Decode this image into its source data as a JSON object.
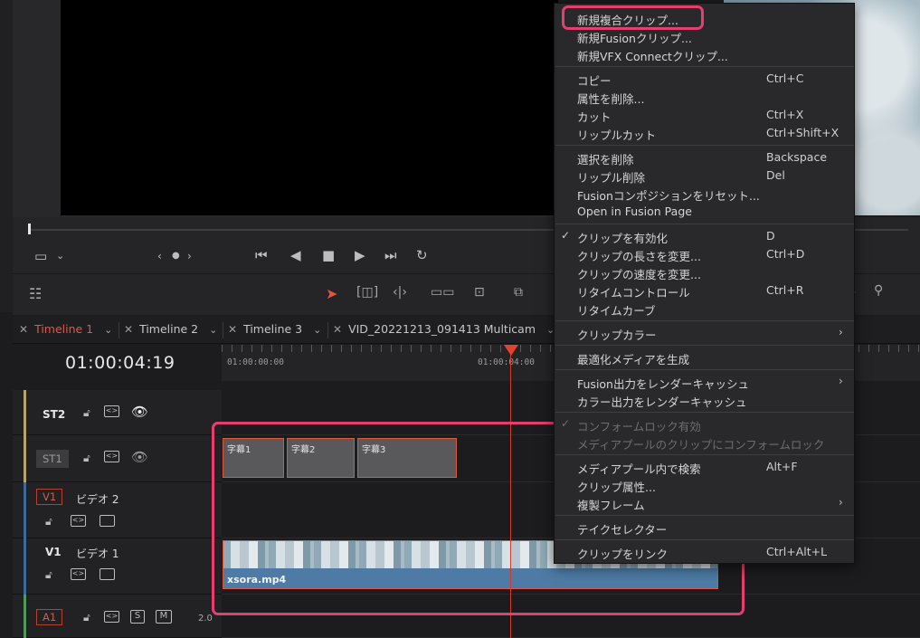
{
  "viewer": {
    "icons": [
      "monitor-icon",
      "chevron-down-icon",
      "chevron-left-icon",
      "dot-icon",
      "chevron-right-icon"
    ],
    "transport": [
      "skip-start-icon",
      "play-reverse-icon",
      "stop-icon",
      "play-icon",
      "skip-end-icon",
      "loop-icon"
    ]
  },
  "tabs": [
    {
      "label": "Timeline 1",
      "active": true
    },
    {
      "label": "Timeline 2",
      "active": false
    },
    {
      "label": "Timeline 3",
      "active": false
    },
    {
      "label": "VID_20221213_091413 Multicam",
      "active": false
    }
  ],
  "timecode": "01:00:04:19",
  "ruler": {
    "labels": [
      "01:00:00:00",
      "01:00:04:00"
    ]
  },
  "tracks": [
    {
      "id": "ST2",
      "name": ""
    },
    {
      "id": "ST1",
      "name": ""
    },
    {
      "id": "V1",
      "name": "ビデオ 2"
    },
    {
      "id": "V1",
      "name": "ビデオ 1"
    },
    {
      "id": "A1",
      "name": "",
      "s": "S",
      "m": "M",
      "level": "2.0"
    }
  ],
  "clips": {
    "subtitles": [
      "字幕1",
      "字幕2",
      "字幕3"
    ],
    "video": "xsora.mp4"
  },
  "menu": {
    "items": [
      {
        "label": "新規複合クリップ...",
        "shortcut": ""
      },
      {
        "label": "新規Fusionクリップ...",
        "shortcut": ""
      },
      {
        "label": "新規VFX Connectクリップ...",
        "shortcut": ""
      },
      {
        "label": "コピー",
        "shortcut": "Ctrl+C"
      },
      {
        "label": "属性を削除...",
        "shortcut": ""
      },
      {
        "label": "カット",
        "shortcut": "Ctrl+X"
      },
      {
        "label": "リップルカット",
        "shortcut": "Ctrl+Shift+X"
      },
      {
        "label": "選択を削除",
        "shortcut": "Backspace"
      },
      {
        "label": "リップル削除",
        "shortcut": "Del"
      },
      {
        "label": "Fusionコンポジションをリセット...",
        "shortcut": ""
      },
      {
        "label": "Open in Fusion Page",
        "shortcut": ""
      },
      {
        "label": "クリップを有効化",
        "shortcut": "D"
      },
      {
        "label": "クリップの長さを変更...",
        "shortcut": "Ctrl+D"
      },
      {
        "label": "クリップの速度を変更...",
        "shortcut": ""
      },
      {
        "label": "リタイムコントロール",
        "shortcut": "Ctrl+R"
      },
      {
        "label": "リタイムカーブ",
        "shortcut": ""
      },
      {
        "label": "クリップカラー",
        "shortcut": ""
      },
      {
        "label": "最適化メディアを生成",
        "shortcut": ""
      },
      {
        "label": "Fusion出力をレンダーキャッシュ",
        "shortcut": ""
      },
      {
        "label": "カラー出力をレンダーキャッシュ",
        "shortcut": ""
      },
      {
        "label": "コンフォームロック有効",
        "shortcut": ""
      },
      {
        "label": "メディアプールのクリップにコンフォームロック",
        "shortcut": ""
      },
      {
        "label": "メディアプール内で検索",
        "shortcut": "Alt+F"
      },
      {
        "label": "クリップ属性...",
        "shortcut": ""
      },
      {
        "label": "複製フレーム",
        "shortcut": ""
      },
      {
        "label": "テイクセレクター",
        "shortcut": ""
      },
      {
        "label": "クリップをリンク",
        "shortcut": "Ctrl+Alt+L"
      }
    ]
  },
  "colors": {
    "accent": "#e8553f",
    "highlight": "#e83e6f",
    "clip_blue": "#4d7ba5"
  }
}
